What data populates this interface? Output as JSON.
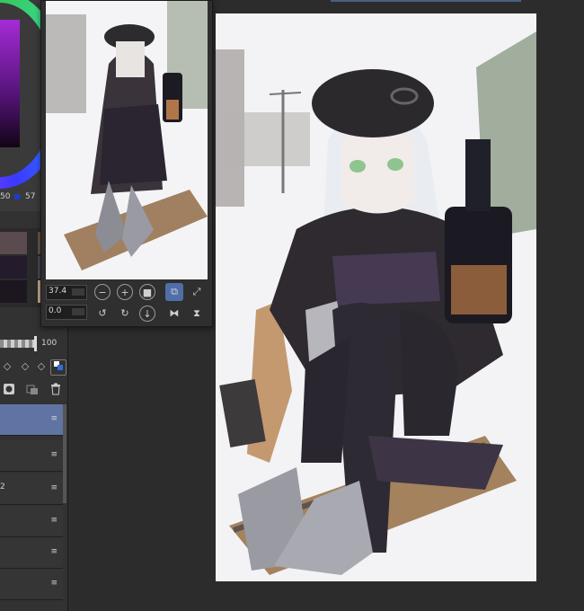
{
  "color_panel": {
    "value_1": "50",
    "value_2": "57"
  },
  "opacity": {
    "value": "100"
  },
  "layers": {
    "partial_label": "2"
  },
  "navigator": {
    "zoom": "37.4",
    "rotation": "0.0",
    "buttons": [
      "zoom-out",
      "zoom-in",
      "fit-to-screen",
      "flip-view",
      "actual-size",
      "rotate-left",
      "rotate-right",
      "reset-rotation",
      "flip-horizontal",
      "flip-vertical"
    ]
  },
  "colors": {
    "selected_layer": "#5f74a3",
    "active_tool": "#4f6fa8",
    "swatches": [
      "#5b4a4e",
      "#6b5547",
      "#241b2c",
      "#4e4458",
      "#1c1620",
      "#6a5e74",
      "#c9a98a",
      "#2a2232"
    ]
  }
}
